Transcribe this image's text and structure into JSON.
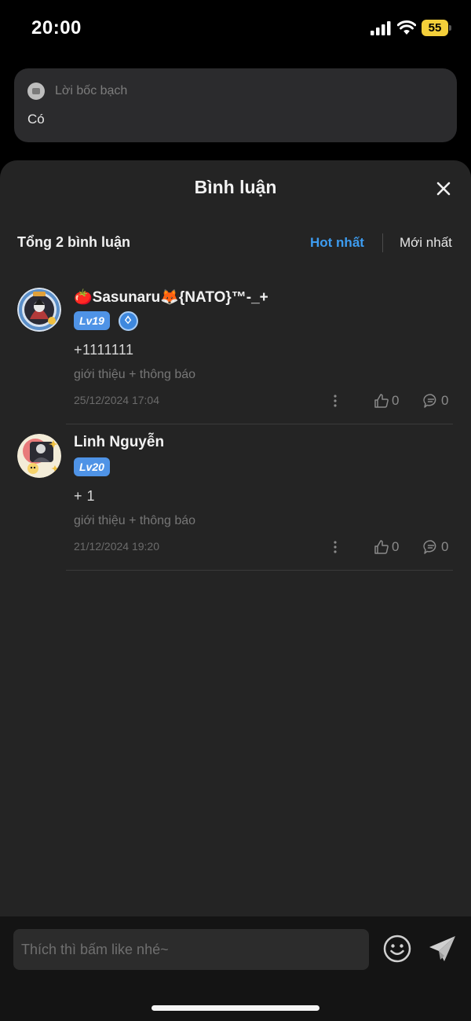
{
  "status_bar": {
    "time": "20:00",
    "battery": "55"
  },
  "confession": {
    "label": "Lời bốc bạch",
    "text": "Có"
  },
  "comments_sheet": {
    "title": "Bình luận",
    "total_label": "Tổng 2 bình luận",
    "sort_options": {
      "hot": "Hot nhất",
      "newest": "Mới nhất"
    },
    "active_sort": "hot",
    "accent_color": "#3d9cf0",
    "comments": [
      {
        "username": "🍅Sasunaru🦊{NATO}™-_+",
        "level": "Lv19",
        "has_vip_badge": true,
        "text": "+1111111",
        "tags": "giới thiệu + thông báo",
        "timestamp": "25/12/2024 17:04",
        "likes": "0",
        "replies": "0"
      },
      {
        "username": "Linh Nguyễn",
        "level": "Lv20",
        "has_vip_badge": false,
        "text": "+ 1",
        "tags": "giới thiệu + thông báo",
        "timestamp": "21/12/2024 19:20",
        "likes": "0",
        "replies": "0"
      }
    ]
  },
  "input_bar": {
    "placeholder": "Thích thì bấm like nhé~"
  },
  "icons": {
    "close": "close-icon",
    "more": "more-vertical-icon",
    "like": "thumbs-up-icon",
    "reply": "chat-bubble-icon",
    "emoji": "smiley-icon",
    "send": "send-icon"
  }
}
